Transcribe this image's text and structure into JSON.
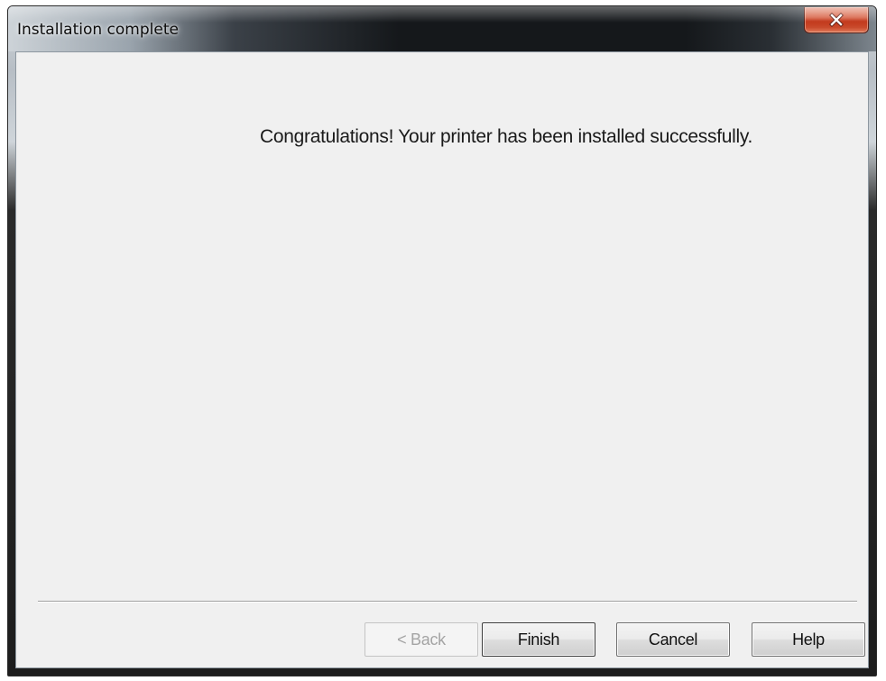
{
  "window": {
    "title": "Installation complete",
    "close_icon": "close-icon"
  },
  "content": {
    "message": "Congratulations! Your printer has been installed successfully."
  },
  "buttons": {
    "back_label": "< Back",
    "finish_label": "Finish",
    "cancel_label": "Cancel",
    "help_label": "Help"
  },
  "colors": {
    "close_button": "#c2381b",
    "client_background": "#f0f0f0"
  }
}
